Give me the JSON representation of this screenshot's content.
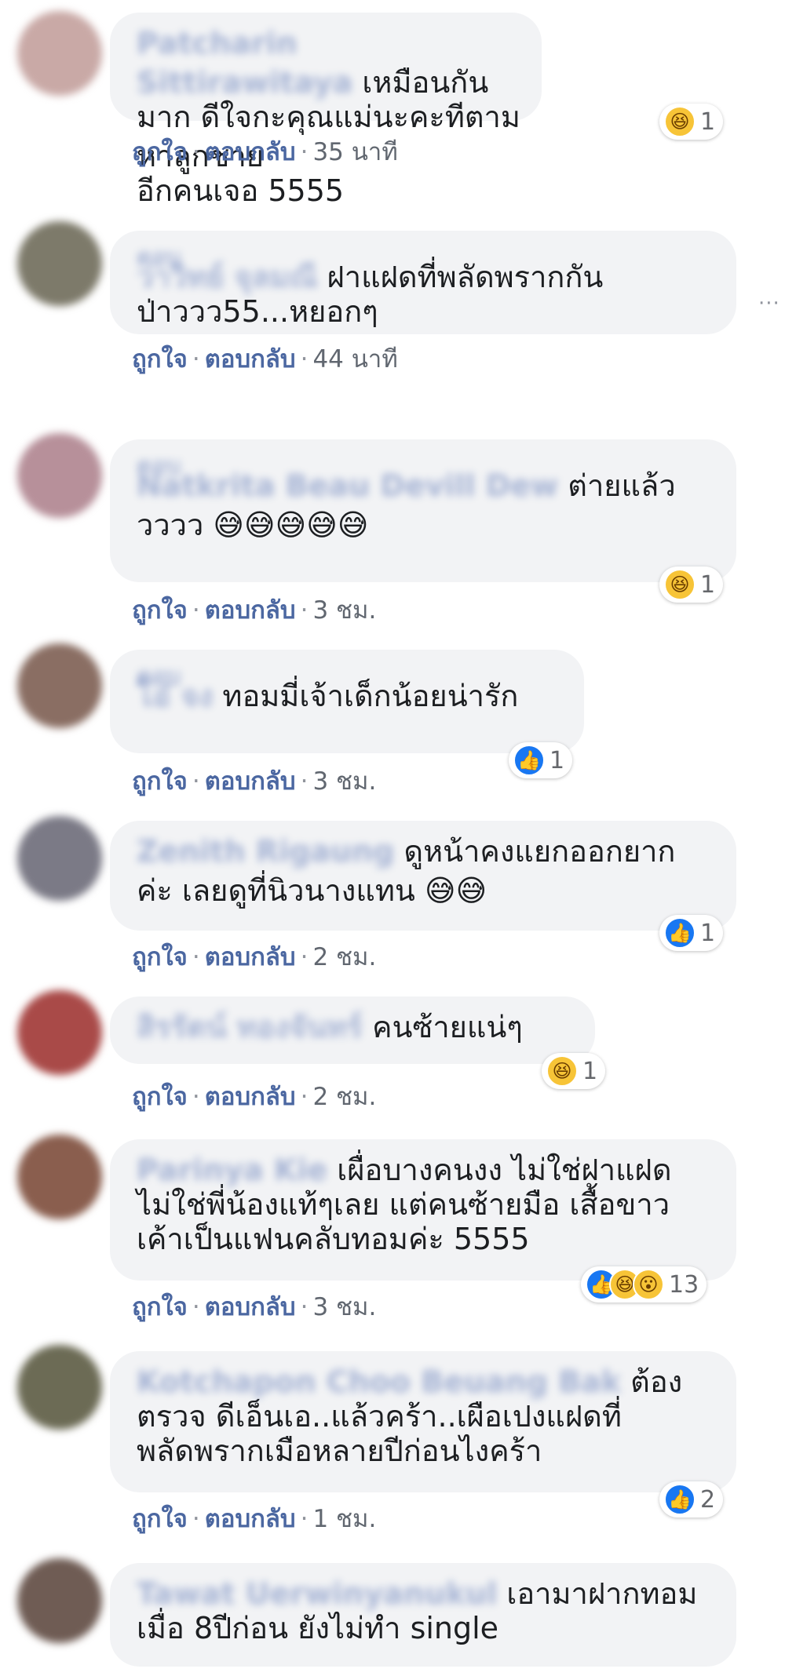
{
  "comments": [
    {
      "name": "Patcharin Sittirawitaya",
      "text": "เหมือนกันมาก ดีใจกะคุณแม่นะคะทีตามหาลูกชายอีกคนเจอ 5555",
      "line1": "เหมือนกัน",
      "line2": "มาก ดีใจกะคุณแม่นะคะทีตามหาลูกชาย",
      "line3": "อีกคนเจอ 5555",
      "time": "35 นาที",
      "reaction_icons": [
        "laugh"
      ],
      "reaction_count": "1",
      "avatar_color": "#c9a9a6"
    },
    {
      "reply_to": "ตอบ",
      "name": "ว่าวิทย์ จุลมณี",
      "line1": "ฝาแฝดที่พลัดพรากกัน",
      "line2": "ป่าววว55...หยอกๆ",
      "time": "44 นาที",
      "avatar_color": "#7d7a6a"
    },
    {
      "reply_to": "ตอบ",
      "name": "Natkrita Beau Devill Dew",
      "line1": "ต่ายแล้ว",
      "line2": "วววว 😅😅😅😅😅",
      "time": "3 ชม.",
      "reaction_icons": [
        "laugh"
      ],
      "reaction_count": "1",
      "avatar_color": "#b7909a"
    },
    {
      "reply_to": "ตอบ",
      "name": "โอ๋ จง",
      "line1": "ทอมมี่เจ้าเด็กน้อยน่ารัก",
      "time": "3 ชม.",
      "reaction_icons": [
        "like"
      ],
      "reaction_count": "1",
      "avatar_color": "#8a6e63"
    },
    {
      "name": "Zenith Rigaung",
      "line1": "ดูหน้าคงแยกออกยาก",
      "line2": "ค่ะ เลยดูที่นิวนางแทน 😅😅",
      "time": "2 ชม.",
      "reaction_icons": [
        "like"
      ],
      "reaction_count": "1",
      "avatar_color": "#7b7a86"
    },
    {
      "name": "สิรรัตน์ ทองจันทร์",
      "line1": "คนซ้ายแน่ๆ",
      "time": "2 ชม.",
      "reaction_icons": [
        "laugh"
      ],
      "reaction_count": "1",
      "avatar_color": "#a94a48"
    },
    {
      "name": "Parinya Kie",
      "line1": "เผื่อบางคนงง ไม่ใช่ฝาแฝด",
      "line2": "ไม่ใช่พี่น้องแท้ๆเลย แต่คนซ้ายมือ เสื้อขาว",
      "line3": "เค้าเป็นแฟนคลับทอมค่ะ 5555",
      "time": "3 ชม.",
      "reaction_icons": [
        "like",
        "laugh",
        "wow"
      ],
      "reaction_count": "13",
      "avatar_color": "#8a5e4e"
    },
    {
      "name": "Kotchapon Choo Beuang Bak",
      "line1": "ต้อง",
      "line2": "ตรวจ ดีเอ็นเอ..แล้วคร้า..เผือเปงแฝดที่",
      "line3": "พลัดพรากเมือหลายปีก่อนไงคร้า",
      "time": "1 ชม.",
      "reaction_icons": [
        "like"
      ],
      "reaction_count": "2",
      "avatar_color": "#6c6b55"
    },
    {
      "name": "Tawat Uerwinyanukul",
      "line1": "เอามาฝากทอม",
      "line2": "เมื่อ 8ปีก่อน ยังไม่ทำ single",
      "avatar_color": "#6f5c54"
    }
  ],
  "actions": {
    "like": "ถูกใจ",
    "reply": "ตอบกลับ",
    "separator": "·"
  },
  "more_menu": "···"
}
